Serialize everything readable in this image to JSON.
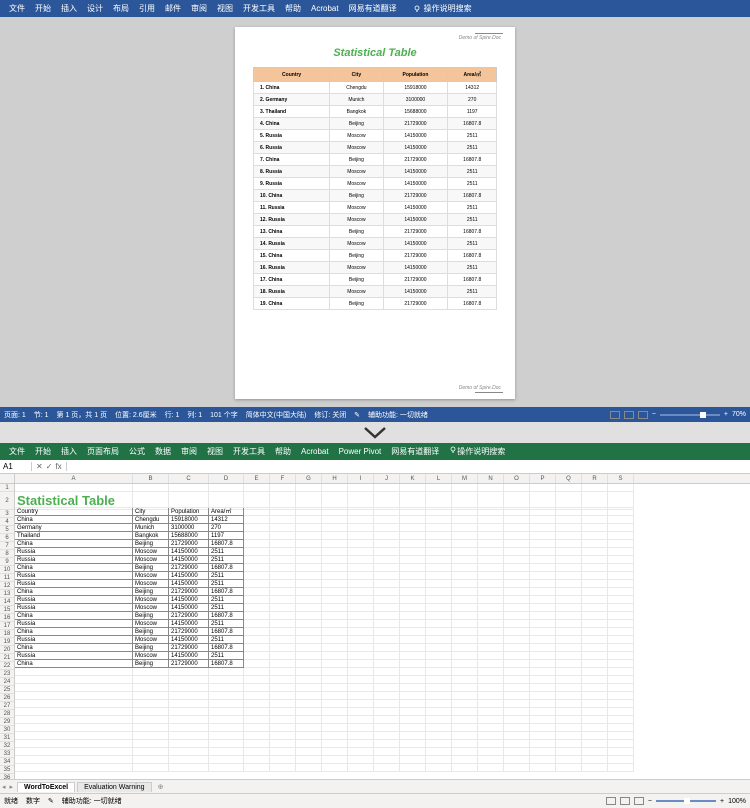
{
  "word": {
    "menu": [
      "文件",
      "开始",
      "插入",
      "设计",
      "布局",
      "引用",
      "邮件",
      "审阅",
      "视图",
      "开发工具",
      "帮助",
      "Acrobat",
      "网易有道翻译"
    ],
    "search_label": "操作说明搜索",
    "watermark": "Demo of Spire.Doc",
    "title": "Statistical Table",
    "headers": [
      "Country",
      "City",
      "Population",
      "Area/㎡"
    ],
    "rows": [
      [
        "1.  China",
        "Chengdu",
        "15918000",
        "14312"
      ],
      [
        "2.  Germany",
        "Munich",
        "3100000",
        "270"
      ],
      [
        "3.  Thailand",
        "Bangkok",
        "15688000",
        "1197"
      ],
      [
        "4.  China",
        "Beijing",
        "21729000",
        "16807.8"
      ],
      [
        "5.  Russia",
        "Moscow",
        "14150000",
        "2511"
      ],
      [
        "6.  Russia",
        "Moscow",
        "14150000",
        "2511"
      ],
      [
        "7.  China",
        "Beijing",
        "21729000",
        "16807.8"
      ],
      [
        "8.  Russia",
        "Moscow",
        "14150000",
        "2511"
      ],
      [
        "9.  Russia",
        "Moscow",
        "14150000",
        "2511"
      ],
      [
        "10. China",
        "Beijing",
        "21729000",
        "16807.8"
      ],
      [
        "11. Russia",
        "Moscow",
        "14150000",
        "2511"
      ],
      [
        "12. Russia",
        "Moscow",
        "14150000",
        "2511"
      ],
      [
        "13. China",
        "Beijing",
        "21729000",
        "16807.8"
      ],
      [
        "14. Russia",
        "Moscow",
        "14150000",
        "2511"
      ],
      [
        "15. China",
        "Beijing",
        "21729000",
        "16807.8"
      ],
      [
        "16. Russia",
        "Moscow",
        "14150000",
        "2511"
      ],
      [
        "17. China",
        "Beijing",
        "21729000",
        "16807.8"
      ],
      [
        "18. Russia",
        "Moscow",
        "14150000",
        "2511"
      ],
      [
        "19. China",
        "Beijing",
        "21729000",
        "16807.8"
      ]
    ],
    "status": {
      "page": "页面: 1",
      "section": "节: 1",
      "pages": "第 1 页，共 1 页",
      "pos": "位置: 2.6厘米",
      "line": "行: 1",
      "col": "列: 1",
      "words": "101 个字",
      "lang": "简体中文(中国大陆)",
      "track": "修订: 关闭",
      "a11y": "辅助功能: 一切就绪",
      "zoom": "70%"
    }
  },
  "excel": {
    "menu": [
      "文件",
      "开始",
      "插入",
      "页面布局",
      "公式",
      "数据",
      "审阅",
      "视图",
      "开发工具",
      "帮助",
      "Acrobat",
      "Power Pivot",
      "网易有道翻译"
    ],
    "search_label": "操作说明搜索",
    "namebox": "A1",
    "fx": "fx",
    "cols": [
      "A",
      "B",
      "C",
      "D",
      "E",
      "F",
      "G",
      "H",
      "I",
      "J",
      "K",
      "L",
      "M",
      "N",
      "O",
      "P",
      "Q",
      "R",
      "S"
    ],
    "title": "Statistical Table",
    "headers": [
      "Country",
      "City",
      "Population",
      "Area/㎡"
    ],
    "rows": [
      [
        "China",
        "Chengdu",
        "15918000",
        "14312"
      ],
      [
        "Germany",
        "Munich",
        "3100000",
        "270"
      ],
      [
        "Thailand",
        "Bangkok",
        "15688000",
        "1197"
      ],
      [
        "China",
        "Beijing",
        "21729000",
        "16807.8"
      ],
      [
        "Russia",
        "Moscow",
        "14150000",
        "2511"
      ],
      [
        "Russia",
        "Moscow",
        "14150000",
        "2511"
      ],
      [
        "China",
        "Beijing",
        "21729000",
        "16807.8"
      ],
      [
        "Russia",
        "Moscow",
        "14150000",
        "2511"
      ],
      [
        "Russia",
        "Moscow",
        "14150000",
        "2511"
      ],
      [
        "China",
        "Beijing",
        "21729000",
        "16807.8"
      ],
      [
        "Russia",
        "Moscow",
        "14150000",
        "2511"
      ],
      [
        "Russia",
        "Moscow",
        "14150000",
        "2511"
      ],
      [
        "China",
        "Beijing",
        "21729000",
        "16807.8"
      ],
      [
        "Russia",
        "Moscow",
        "14150000",
        "2511"
      ],
      [
        "China",
        "Beijing",
        "21729000",
        "16807.8"
      ],
      [
        "Russia",
        "Moscow",
        "14150000",
        "2511"
      ],
      [
        "China",
        "Beijing",
        "21729000",
        "16807.8"
      ],
      [
        "Russia",
        "Moscow",
        "14150000",
        "2511"
      ],
      [
        "China",
        "Beijing",
        "21729000",
        "16807.8"
      ]
    ],
    "tabs": [
      "WordToExcel",
      "Evaluation Warning"
    ],
    "status": {
      "ready": "就绪",
      "a11y_label": "辅助功能: 一切就绪",
      "calc": "数字",
      "zoom": "100%"
    }
  }
}
